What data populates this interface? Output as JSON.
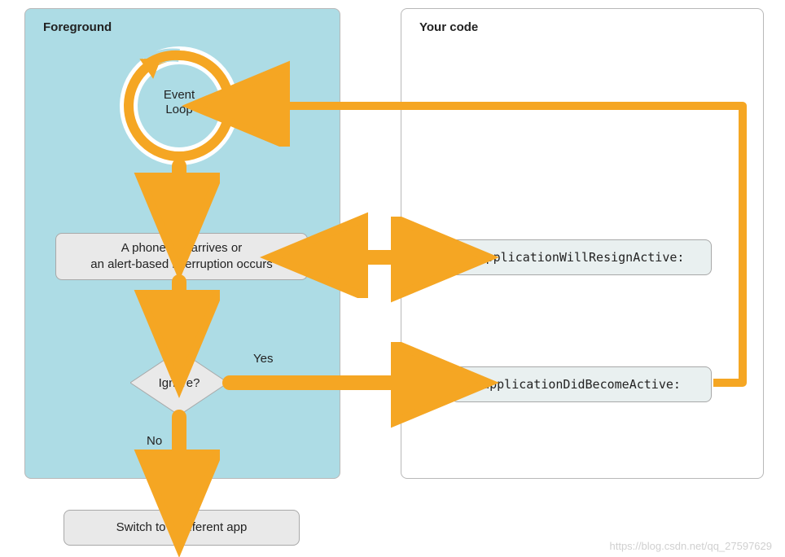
{
  "panels": {
    "foreground": {
      "title": "Foreground"
    },
    "your_code": {
      "title": "Your code"
    }
  },
  "nodes": {
    "event_loop": "Event\nLoop",
    "interruption": "A phone call arrives or\nan alert-based interruption occurs",
    "ignore": "Ignore?",
    "switch_app": "Switch to a different app",
    "will_resign": "applicationWillResignActive:",
    "did_become": "applicationDidBecomeActive:"
  },
  "edges": {
    "yes": "Yes",
    "no": "No"
  },
  "colors": {
    "accent": "#f5a623",
    "panel_blue": "#addce5",
    "box_grey": "#e9e9e9",
    "box_code": "#e9f0f0"
  },
  "watermark": "https://blog.csdn.net/qq_27597629"
}
